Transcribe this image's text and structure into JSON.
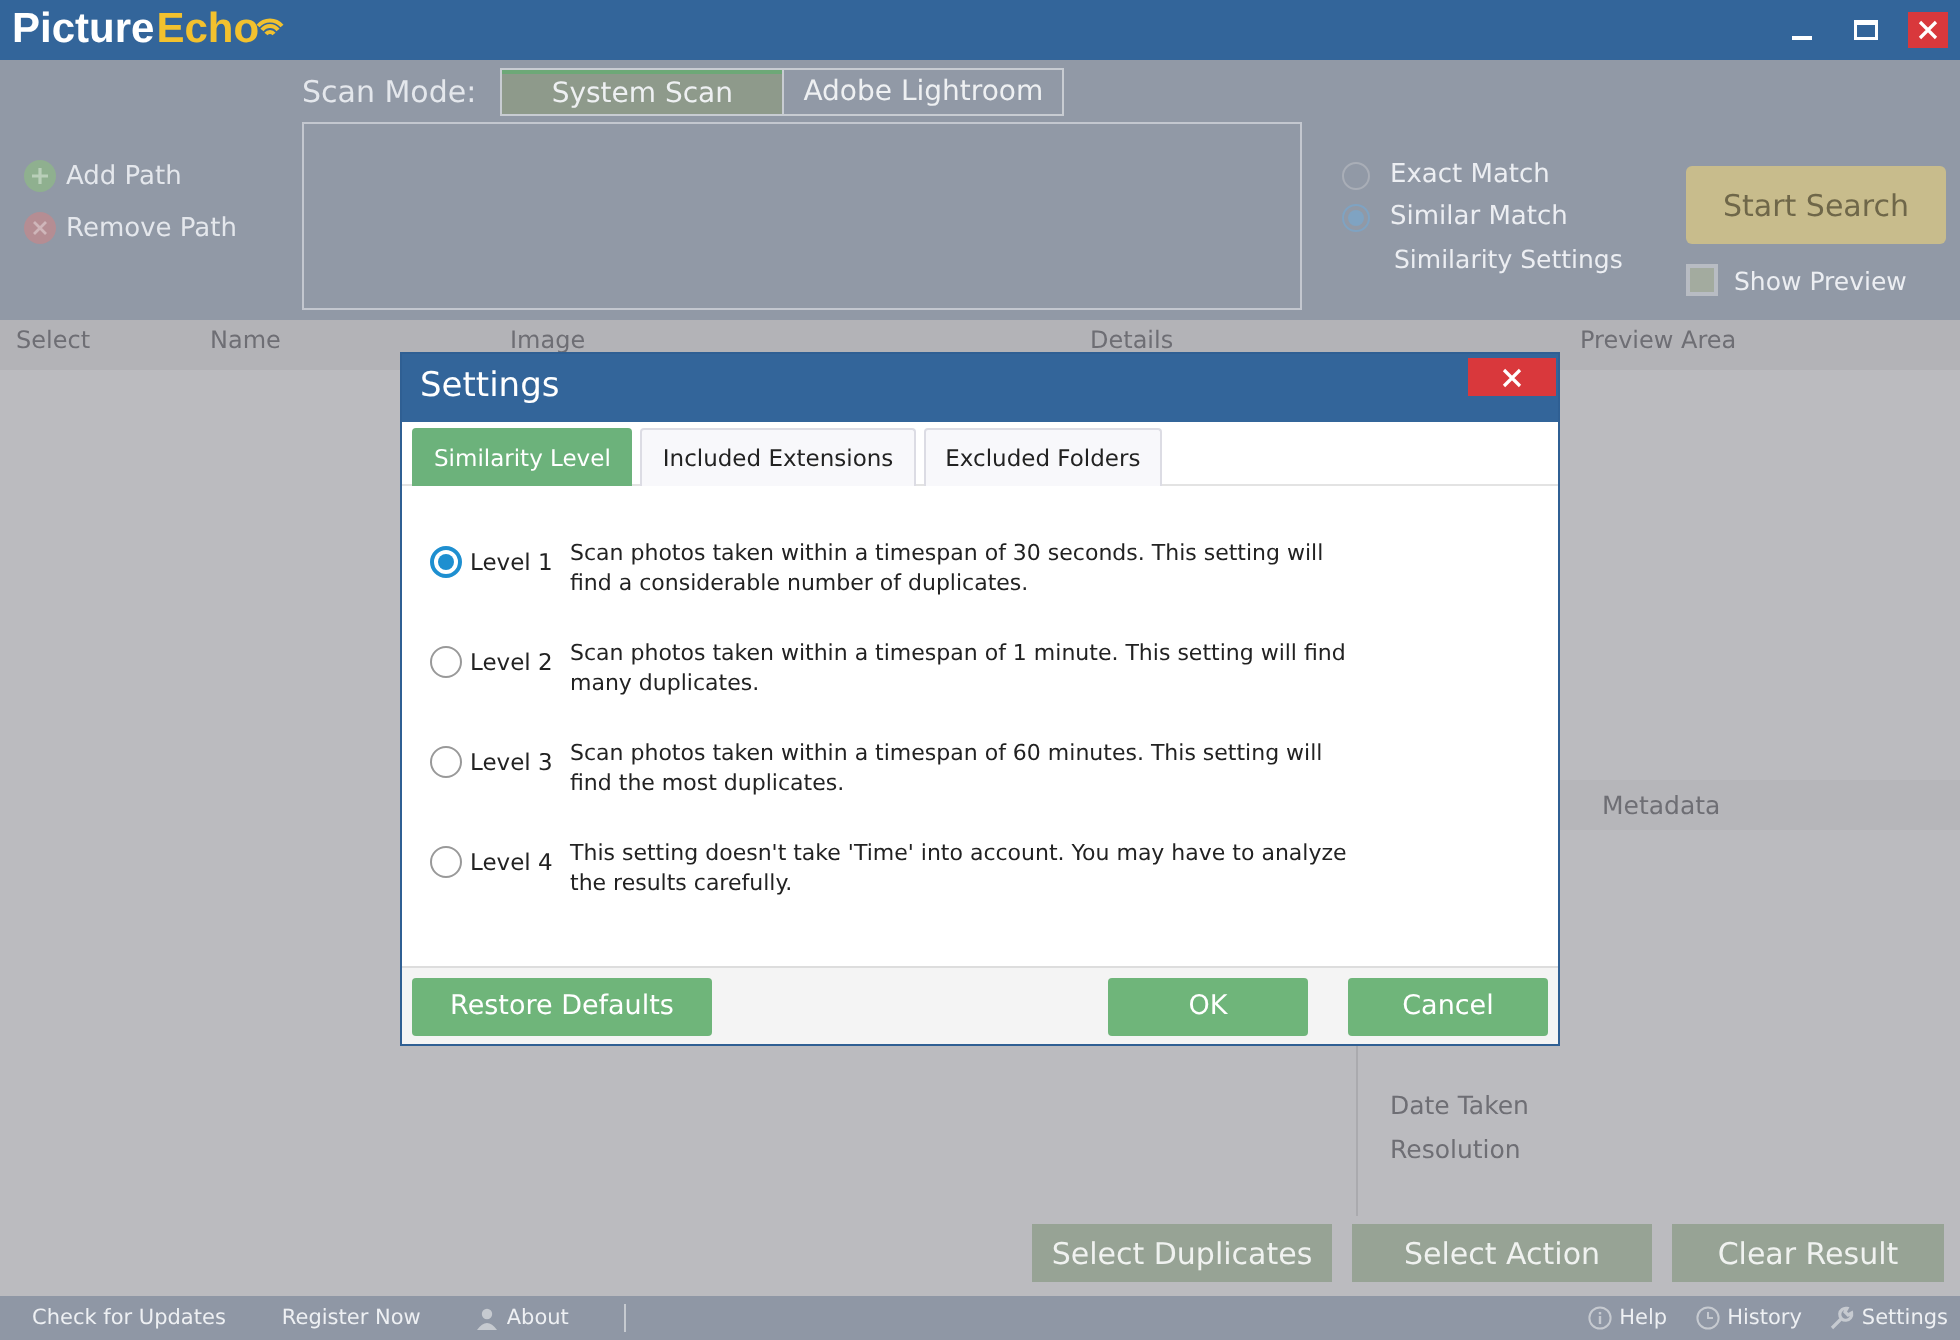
{
  "logo": {
    "first": "Picture",
    "second": "Echo"
  },
  "scan_mode": {
    "label": "Scan Mode:",
    "tabs": [
      {
        "label": "System Scan",
        "selected": true
      },
      {
        "label": "Adobe Lightroom",
        "selected": false
      }
    ]
  },
  "path_actions": [
    {
      "kind": "add",
      "label": "Add Path"
    },
    {
      "kind": "remove",
      "label": "Remove Path"
    }
  ],
  "match_options": [
    {
      "label": "Exact Match",
      "selected": false
    },
    {
      "label": "Similar Match",
      "selected": true
    }
  ],
  "similarity_settings_link": "Similarity Settings",
  "start_button": "Start Search",
  "show_preview": {
    "label": "Show Preview",
    "checked": false
  },
  "table": {
    "columns": [
      "Select",
      "Name",
      "Image",
      "Details"
    ]
  },
  "preview": {
    "title": "Preview Area",
    "metadata_title": "Metadata",
    "metadata_items": [
      "Date Taken",
      "Resolution"
    ]
  },
  "result_buttons": [
    "Select Duplicates",
    "Select Action",
    "Clear Result"
  ],
  "status_bar": {
    "left": [
      {
        "kind": "link",
        "label": "Check for Updates"
      },
      {
        "kind": "link",
        "label": "Register Now"
      },
      {
        "kind": "person",
        "label": "About"
      }
    ],
    "right": [
      {
        "kind": "info",
        "label": "Help"
      },
      {
        "kind": "clock",
        "label": "History"
      },
      {
        "kind": "wrench",
        "label": "Settings"
      }
    ]
  },
  "dialog": {
    "title": "Settings",
    "tabs": [
      {
        "label": "Similarity Level",
        "selected": true
      },
      {
        "label": "Included Extensions",
        "selected": false
      },
      {
        "label": "Excluded Folders",
        "selected": false
      }
    ],
    "levels": [
      {
        "label": "Level 1",
        "selected": true,
        "description": "Scan photos taken within a timespan of 30 seconds. This setting will find a considerable number of duplicates."
      },
      {
        "label": "Level 2",
        "selected": false,
        "description": "Scan photos taken within a timespan of 1 minute. This setting will find many duplicates."
      },
      {
        "label": "Level 3",
        "selected": false,
        "description": "Scan photos taken within a timespan of 60 minutes. This setting will find the most duplicates."
      },
      {
        "label": "Level 4",
        "selected": false,
        "description": "This setting doesn't take 'Time' into account. You may have to analyze the results carefully."
      }
    ],
    "restore_button": "Restore Defaults",
    "ok_button": "OK",
    "cancel_button": "Cancel"
  }
}
